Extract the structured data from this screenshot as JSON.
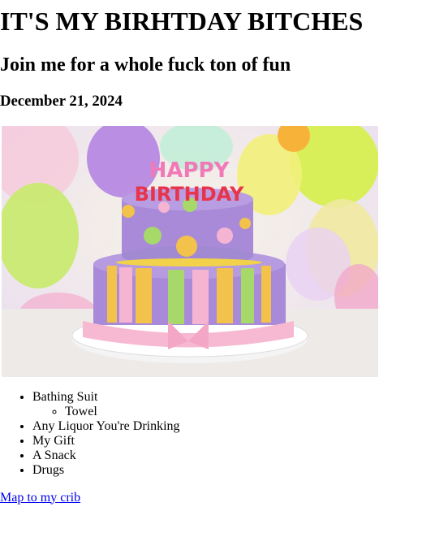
{
  "title": "IT'S MY BIRHTDAY BITCHES",
  "subtitle": "Join me for a whole fuck ton of fun",
  "date": "December 21, 2024",
  "image": {
    "alt": "Birthday cake with Happy Birthday candles",
    "candle_text": "HAPPY BIRTHDAY"
  },
  "list": {
    "items": [
      {
        "label": "Bathing Suit",
        "sub": [
          "Towel"
        ]
      },
      {
        "label": "Any Liquor You're Drinking"
      },
      {
        "label": "My Gift"
      },
      {
        "label": "A Snack"
      },
      {
        "label": "Drugs"
      }
    ]
  },
  "link": {
    "label": "Map to my crib"
  }
}
